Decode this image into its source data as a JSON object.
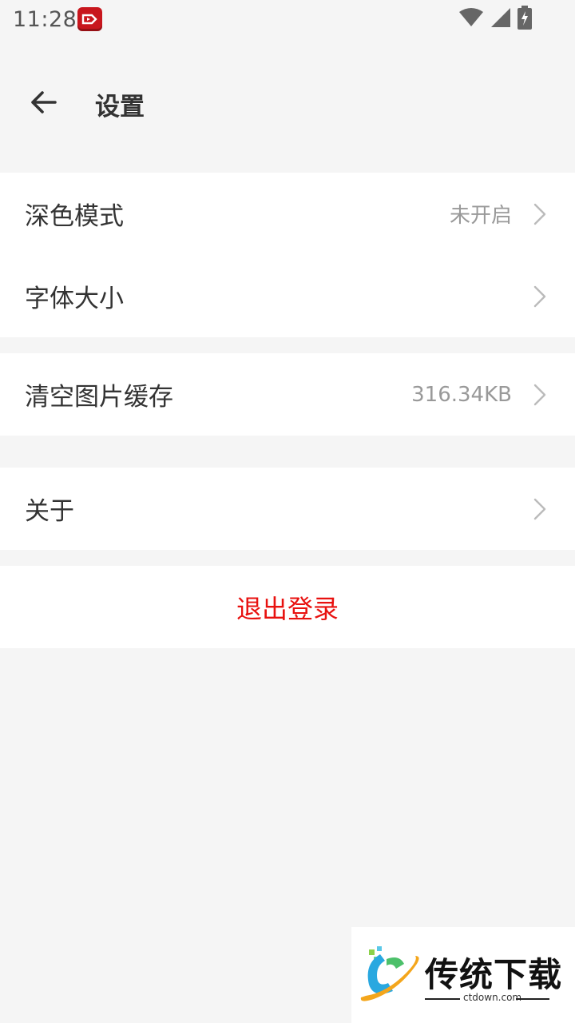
{
  "status_bar": {
    "time": "11:28",
    "icons": [
      "app-notification-icon",
      "wifi-icon",
      "signal-icon",
      "battery-charging-icon"
    ]
  },
  "header": {
    "title": "设置",
    "back_icon": "arrow-left-icon"
  },
  "settings": {
    "group1": [
      {
        "label": "深色模式",
        "value": "未开启"
      },
      {
        "label": "字体大小",
        "value": ""
      }
    ],
    "group2": [
      {
        "label": "清空图片缓存",
        "value": "316.34KB"
      }
    ],
    "group3": [
      {
        "label": "关于",
        "value": ""
      }
    ],
    "logout_label": "退出登录"
  },
  "watermark": {
    "text": "传统下载",
    "url": "ctdown.com"
  },
  "colors": {
    "background": "#f5f5f5",
    "card": "#ffffff",
    "logout": "#e8110f",
    "secondary_text": "#999999",
    "primary_text": "#333333"
  }
}
